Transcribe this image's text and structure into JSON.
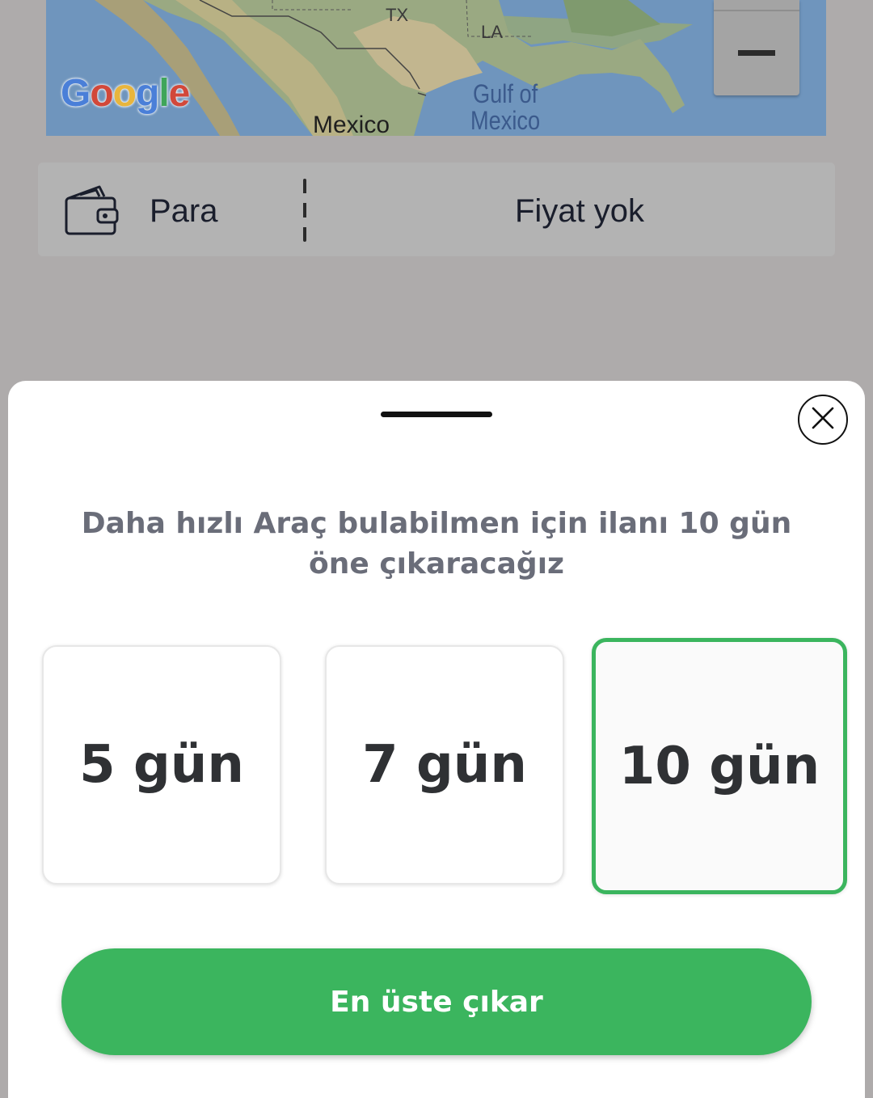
{
  "map": {
    "labels": {
      "tx": "TX",
      "la": "LA",
      "mexico": "Mexico",
      "gulf_line1": "Gulf of",
      "gulf_line2": "Mexico"
    },
    "logo": {
      "g1": "G",
      "o1": "o",
      "o2": "o",
      "g2": "g",
      "l": "l",
      "e": "e"
    },
    "zoom_out_icon": "minus-icon"
  },
  "price_row": {
    "icon": "wallet-icon",
    "label": "Para",
    "value": "Fiyat yok"
  },
  "sheet": {
    "close_icon": "close-icon",
    "message": "Daha hızlı Araç bulabilmen için ilanı 10 gün öne çıkaracağız",
    "options": [
      {
        "label": "5 gün",
        "selected": false
      },
      {
        "label": "7 gün",
        "selected": false
      },
      {
        "label": "10 gün",
        "selected": true
      }
    ],
    "cta_label": "En üste çıkar"
  },
  "colors": {
    "accent": "#3bb55e",
    "overlay": "#aeabab",
    "message_text": "#6a6d79"
  }
}
